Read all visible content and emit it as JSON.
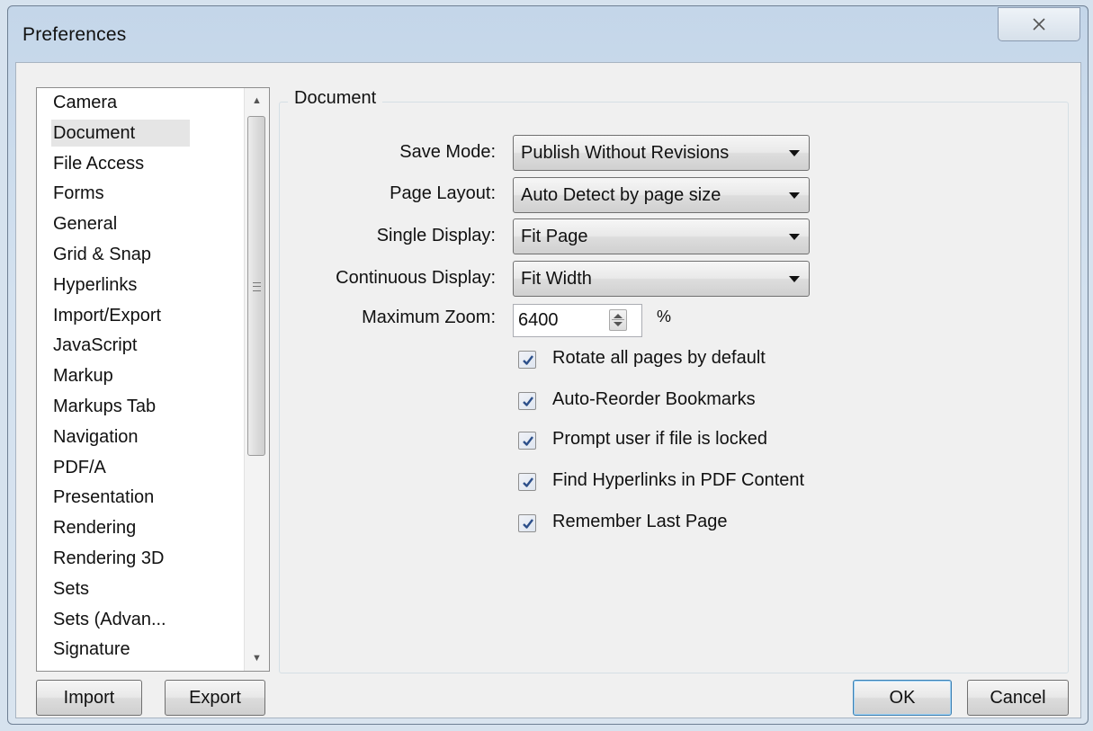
{
  "window": {
    "title": "Preferences",
    "close_icon": "close-x-icon"
  },
  "sidebar": {
    "items": [
      {
        "label": "Camera",
        "selected": false
      },
      {
        "label": "Document",
        "selected": true
      },
      {
        "label": "File Access",
        "selected": false
      },
      {
        "label": "Forms",
        "selected": false
      },
      {
        "label": "General",
        "selected": false
      },
      {
        "label": "Grid & Snap",
        "selected": false
      },
      {
        "label": "Hyperlinks",
        "selected": false
      },
      {
        "label": "Import/Export",
        "selected": false
      },
      {
        "label": "JavaScript",
        "selected": false
      },
      {
        "label": "Markup",
        "selected": false
      },
      {
        "label": "Markups Tab",
        "selected": false
      },
      {
        "label": "Navigation",
        "selected": false
      },
      {
        "label": "PDF/A",
        "selected": false
      },
      {
        "label": "Presentation",
        "selected": false
      },
      {
        "label": "Rendering",
        "selected": false
      },
      {
        "label": "Rendering 3D",
        "selected": false
      },
      {
        "label": "Sets",
        "selected": false
      },
      {
        "label": "Sets (Advan...",
        "selected": false
      },
      {
        "label": "Signature",
        "selected": false
      }
    ]
  },
  "footer": {
    "import_label": "Import",
    "export_label": "Export",
    "ok_label": "OK",
    "cancel_label": "Cancel"
  },
  "document": {
    "group_title": "Document",
    "save_mode": {
      "label": "Save Mode:",
      "value": "Publish Without Revisions"
    },
    "page_layout": {
      "label": "Page Layout:",
      "value": "Auto Detect by page size"
    },
    "single_display": {
      "label": "Single Display:",
      "value": "Fit Page"
    },
    "continuous_display": {
      "label": "Continuous Display:",
      "value": "Fit Width"
    },
    "maximum_zoom": {
      "label": "Maximum Zoom:",
      "value": "6400",
      "unit": "%"
    },
    "checkboxes": [
      {
        "label": "Rotate all pages by default",
        "checked": true
      },
      {
        "label": "Auto-Reorder Bookmarks",
        "checked": true
      },
      {
        "label": "Prompt user if file is locked",
        "checked": true
      },
      {
        "label": "Find Hyperlinks in PDF Content",
        "checked": true
      },
      {
        "label": "Remember Last Page",
        "checked": true
      }
    ]
  },
  "colors": {
    "accent_border": "#3c7fb1",
    "checkmark": "#2c4f8a",
    "selection": "#e5e5e5"
  }
}
